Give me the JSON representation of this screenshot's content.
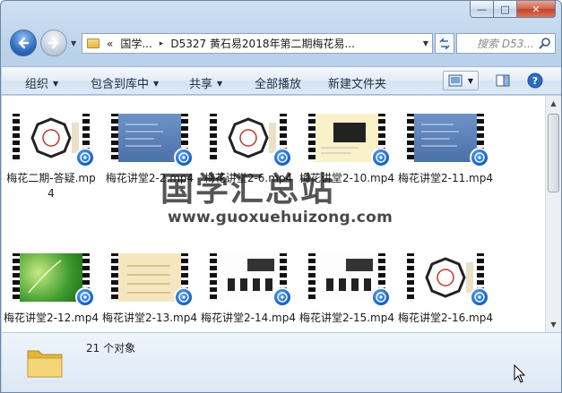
{
  "window": {
    "caption_buttons": {
      "minimize": "—",
      "maximize": "□",
      "close": "✕"
    }
  },
  "address_bar": {
    "prefix": "«",
    "segments": [
      "国学...",
      "D5327 黄石易2018年第二期梅花易..."
    ],
    "separator": "▸",
    "search_placeholder": "搜索 D53..."
  },
  "toolbar": {
    "organize": "组织",
    "include_in_library": "包含到库中",
    "share": "共享",
    "play_all": "全部播放",
    "new_folder": "新建文件夹"
  },
  "watermark": {
    "title": "国学汇总站",
    "url": "www.guoxuehuizong.com"
  },
  "files": [
    {
      "name": "梅花二期-答疑.mp4",
      "thumb": "bagua"
    },
    {
      "name": "梅花讲堂2-2.mp4",
      "thumb": "blue"
    },
    {
      "name": "梅花讲堂2-6.mp4",
      "thumb": "bagua"
    },
    {
      "name": "梅花讲堂2-10.mp4",
      "thumb": "cream"
    },
    {
      "name": "梅花讲堂2-11.mp4",
      "thumb": "blue"
    },
    {
      "name": "梅花讲堂2-12.mp4",
      "thumb": "green"
    },
    {
      "name": "梅花讲堂2-13.mp4",
      "thumb": "paper"
    },
    {
      "name": "梅花讲堂2-14.mp4",
      "thumb": "white"
    },
    {
      "name": "梅花讲堂2-15.mp4",
      "thumb": "white"
    },
    {
      "name": "梅花讲堂2-16.mp4",
      "thumb": "bagua"
    }
  ],
  "status": {
    "count": "21 个对象"
  }
}
